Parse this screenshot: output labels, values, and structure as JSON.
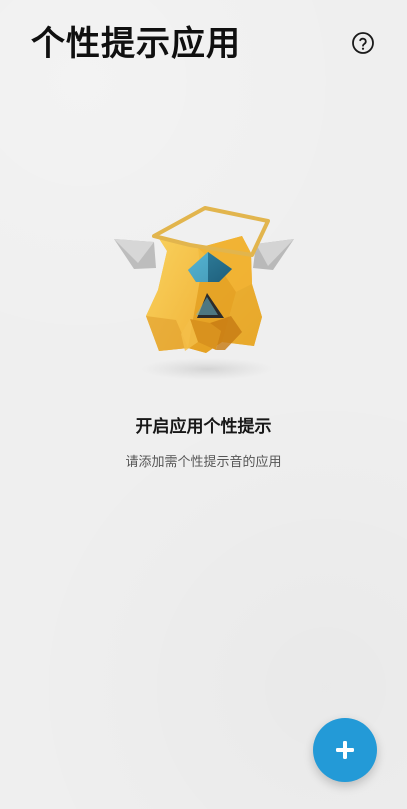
{
  "header": {
    "title": "个性提示应用"
  },
  "icons": {
    "help": "question-circle-icon",
    "add": "plus-icon",
    "illustration": "mascot-icon"
  },
  "empty_state": {
    "title": "开启应用个性提示",
    "subtitle": "请添加需个性提示音的应用"
  },
  "colors": {
    "background": "#efefef",
    "accent": "#239ad7",
    "mascot_yellow": "#f3b63b",
    "mascot_halo": "#e2b54d",
    "mascot_blue": "#2f88a5"
  }
}
